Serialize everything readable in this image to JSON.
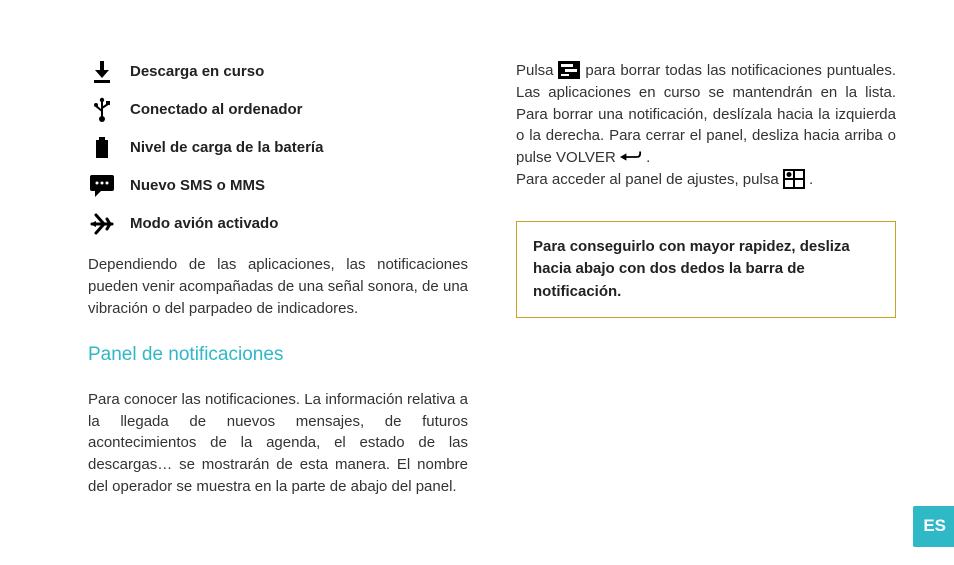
{
  "left": {
    "icons": [
      {
        "label": "Descarga en curso"
      },
      {
        "label": "Conectado al ordenador"
      },
      {
        "label": "Nivel de carga de la batería"
      },
      {
        "label": "Nuevo SMS o MMS"
      },
      {
        "label": "Modo avión activado"
      }
    ],
    "note": "Dependiendo de las aplicaciones, las notificaciones pueden venir acompañadas de una señal sonora, de una vibración o del parpadeo de indicadores.",
    "section_title": "Panel de notificaciones",
    "panel_text": "Para conocer las notificaciones. La información relativa a la llegada de nuevos mensajes, de futuros acontecimientos de la agenda, el estado de las descargas… se mostrarán de esta manera. El nombre del operador se muestra en la parte de abajo del panel."
  },
  "right": {
    "p1a": "Pulsa ",
    "p1b": " para borrar todas las notificaciones puntuales. Las aplicaciones en curso se mantendrán en la lista. Para borrar una notificación, deslízala hacia la izquierda o la derecha. Para cerrar el panel, desliza hacia arriba o pulse VOLVER ",
    "p1c": " .",
    "p2a": "Para acceder al panel de ajustes, pulsa ",
    "p2b": " .",
    "tip": "Para conseguirlo con mayor rapidez, desliza  hacia abajo con dos dedos la barra de notificación."
  },
  "lang": "ES"
}
